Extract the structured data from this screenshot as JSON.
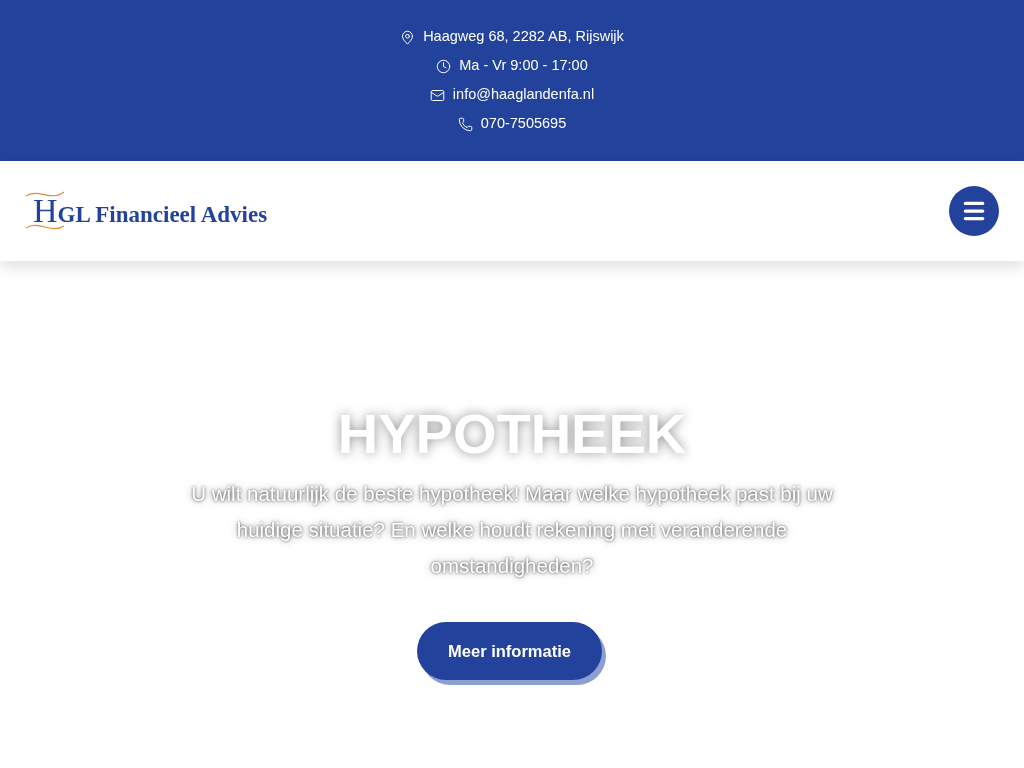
{
  "contact_bar": [
    {
      "kind": "address",
      "text": "Haagweg 68, 2282 AB, Rijswijk"
    },
    {
      "kind": "hours",
      "text": "Ma - Vr 9:00 - 17:00"
    },
    {
      "kind": "email",
      "text": "info@haaglandenfa.nl"
    },
    {
      "kind": "phone",
      "text": "070-7505695"
    }
  ],
  "header": {
    "logo": "HGL Financieel Advies"
  },
  "hero": {
    "title": "HYPOTHEEK",
    "text": "U wilt natuurlijk de beste hypotheek! Maar welke hypotheek past bij uw huidige situatie? En welke houdt rekening met veranderende omstandigheden?",
    "button": "Meer informatie"
  }
}
